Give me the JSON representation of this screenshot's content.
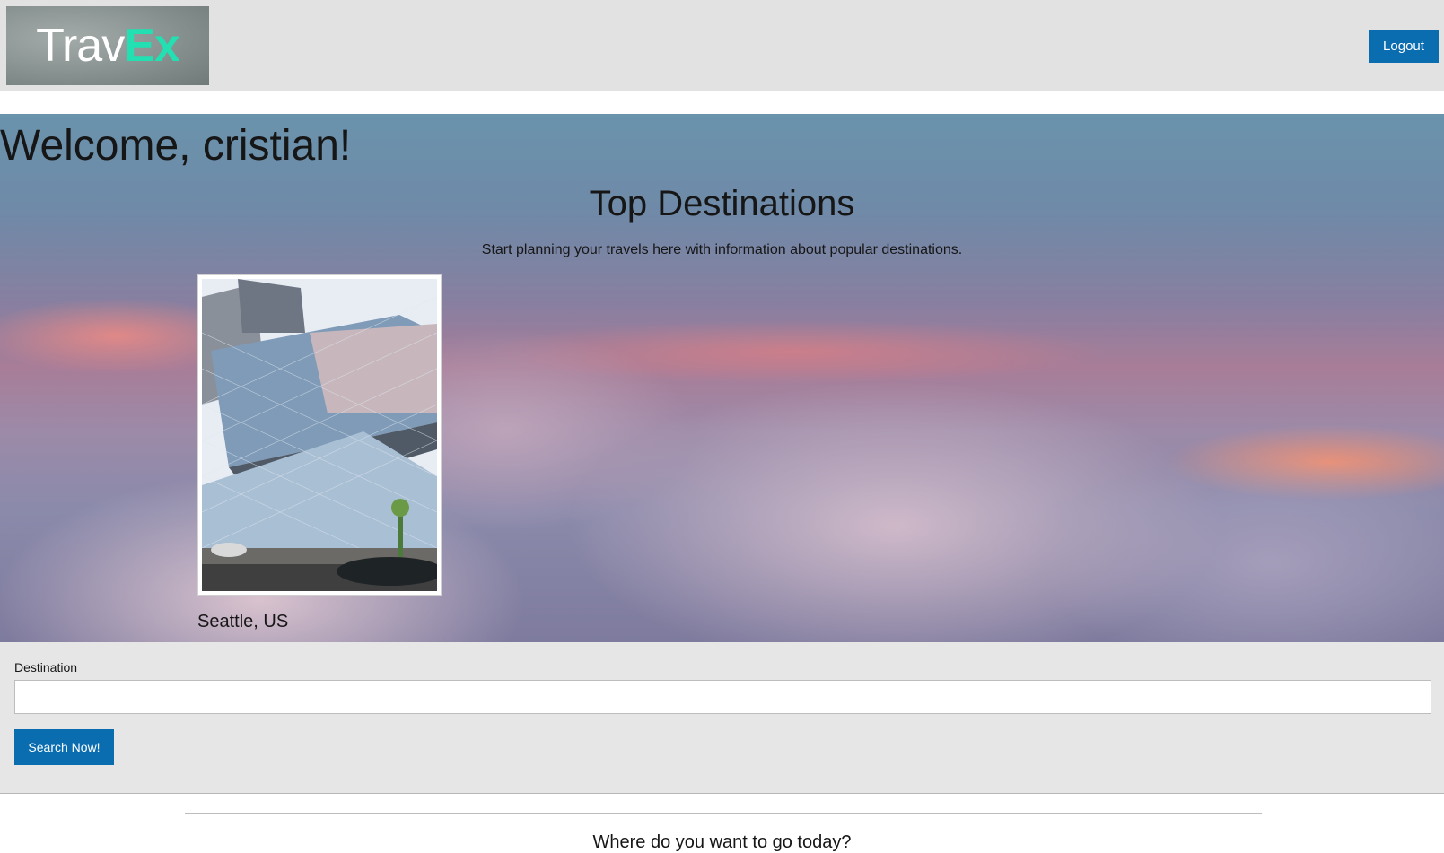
{
  "header": {
    "logo": {
      "part1": "Trav",
      "part2": "Ex"
    },
    "logout_label": "Logout"
  },
  "hero": {
    "welcome": "Welcome, cristian!",
    "title": "Top Destinations",
    "subtitle": "Start planning your travels here with information about popular destinations."
  },
  "destinations": [
    {
      "name": "Seattle, US"
    }
  ],
  "search": {
    "label": "Destination",
    "value": "",
    "placeholder": "",
    "button_label": "Search Now!"
  },
  "bottom": {
    "question": "Where do you want to go today?"
  },
  "colors": {
    "accent": "#0a6db0",
    "logo_ex": "#22e0b2",
    "header_bg": "#e2e2e2",
    "panel_bg": "#e6e6e6"
  }
}
